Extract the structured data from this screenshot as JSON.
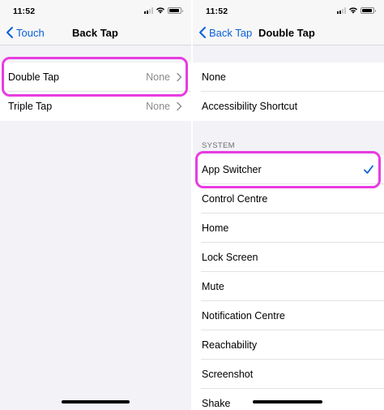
{
  "colors": {
    "accent": "#0a60d6",
    "highlight": "#e83ce0",
    "secondary_text": "#8a8a8e",
    "grouped_background": "#f2f2f7"
  },
  "left_screen": {
    "status_time": "11:52",
    "nav": {
      "back_label": "Touch",
      "title": "Back Tap"
    },
    "rows": [
      {
        "label": "Double Tap",
        "value": "None",
        "highlighted": true
      },
      {
        "label": "Triple Tap",
        "value": "None",
        "highlighted": false
      }
    ]
  },
  "right_screen": {
    "status_time": "11:52",
    "nav": {
      "back_label": "Back Tap",
      "title": "Double Tap"
    },
    "top_options": [
      "None",
      "Accessibility Shortcut"
    ],
    "section_header": "SYSTEM",
    "system_options": [
      {
        "label": "App Switcher",
        "selected": true,
        "highlighted": true
      },
      {
        "label": "Control Centre",
        "selected": false
      },
      {
        "label": "Home",
        "selected": false
      },
      {
        "label": "Lock Screen",
        "selected": false
      },
      {
        "label": "Mute",
        "selected": false
      },
      {
        "label": "Notification Centre",
        "selected": false
      },
      {
        "label": "Reachability",
        "selected": false
      },
      {
        "label": "Screenshot",
        "selected": false
      },
      {
        "label": "Shake",
        "selected": false
      }
    ],
    "icons": {
      "checkmark": "checkmark-icon",
      "back": "chevron-left-icon"
    }
  }
}
